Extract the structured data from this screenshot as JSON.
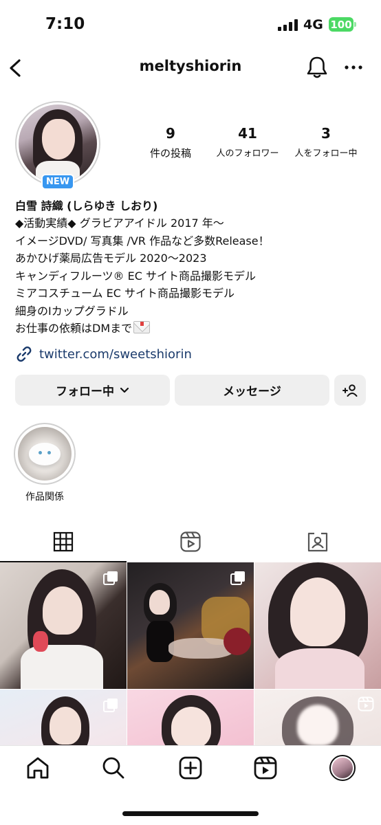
{
  "status_bar": {
    "time": "7:10",
    "network": "4G",
    "battery": "100",
    "battery_color": "#4cd964"
  },
  "nav": {
    "username": "meltyshiorin",
    "icons": [
      "chevron-left-icon",
      "bell-icon",
      "more-horizontal-icon"
    ]
  },
  "profile": {
    "new_badge": "NEW",
    "stats": [
      {
        "value": "9",
        "label": "件の投稿"
      },
      {
        "value": "41",
        "label": "人のフォロワー"
      },
      {
        "value": "3",
        "label": "人をフォロー中"
      }
    ],
    "display_name": "白雪 詩織 (しらゆき しおり)",
    "bio_lines": [
      "◆活動実績◆ グラビアアイドル 2017 年〜",
      "イメージDVD/ 写真集 /VR 作品など多数Release！",
      "あかひげ薬局広告モデル 2020〜2023",
      "キャンディフルーツ® EC サイト商品撮影モデル",
      "ミアコスチューム EC サイト商品撮影モデル",
      "細身のIカップグラドル",
      "お仕事の依頼はDMまで"
    ],
    "link": "twitter.com/sweetshiorin"
  },
  "actions": {
    "follow_label": "フォロー中",
    "message_label": "メッセージ"
  },
  "highlights": [
    {
      "label": "作品関係"
    }
  ],
  "tabs": [
    "grid-icon",
    "reels-icon",
    "tagged-icon"
  ],
  "accent_color": "#3897f0",
  "link_color": "#1a3a6b"
}
